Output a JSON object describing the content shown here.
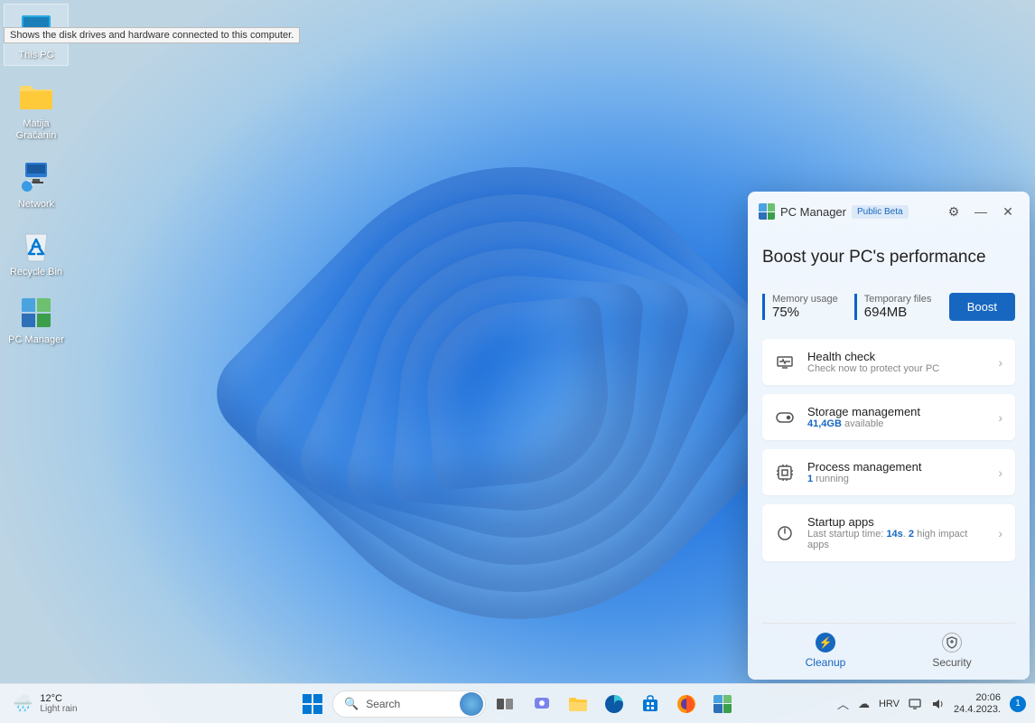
{
  "desktop": {
    "icons": [
      {
        "name": "this-pc",
        "label": "This PC",
        "selected": true
      },
      {
        "name": "user-folder",
        "label": "Matija Gračanin"
      },
      {
        "name": "network",
        "label": "Network"
      },
      {
        "name": "recycle-bin",
        "label": "Recycle Bin"
      },
      {
        "name": "pc-manager-shortcut",
        "label": "PC Manager"
      }
    ],
    "tooltip": "Shows the disk drives and hardware connected to this computer."
  },
  "pc_manager": {
    "title": "PC Manager",
    "badge": "Public Beta",
    "heading": "Boost your PC's performance",
    "stats": {
      "memory": {
        "label": "Memory usage",
        "value": "75%"
      },
      "temp": {
        "label": "Temporary files",
        "value": "694MB"
      }
    },
    "boost_label": "Boost",
    "cards": {
      "health": {
        "title": "Health check",
        "sub": "Check now to protect your PC"
      },
      "storage": {
        "title": "Storage management",
        "hi": "41,4GB",
        "sub_rest": " available"
      },
      "process": {
        "title": "Process management",
        "hi": "1",
        "sub_rest": " running"
      },
      "startup": {
        "title": "Startup apps",
        "sub_prefix": "Last startup time: ",
        "hi1": "14s",
        "sep": ". ",
        "hi2": "2",
        "sub_rest": " high impact apps"
      }
    },
    "tabs": {
      "cleanup": "Cleanup",
      "security": "Security"
    }
  },
  "taskbar": {
    "weather": {
      "temp": "12°C",
      "desc": "Light rain"
    },
    "search": "Search",
    "lang": "HRV",
    "time": "20:06",
    "date": "24.4.2023.",
    "notif": "1"
  }
}
